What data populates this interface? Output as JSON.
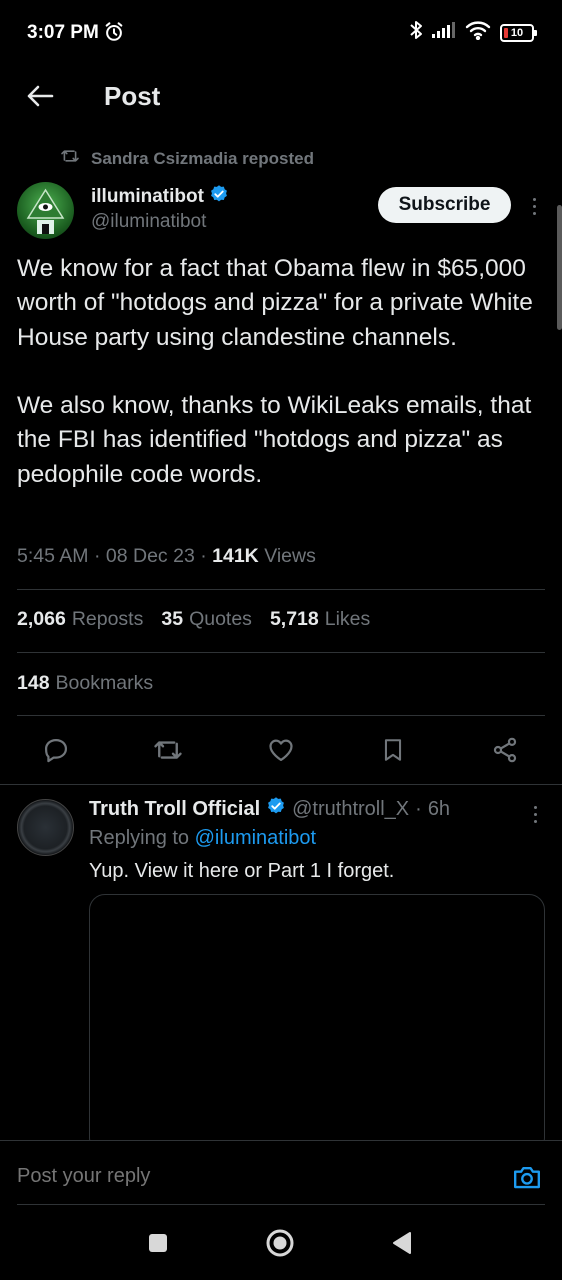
{
  "status_bar": {
    "time": "3:07 PM",
    "battery": "10",
    "icons": [
      "alarm-icon",
      "bluetooth-icon",
      "signal-icon",
      "wifi-icon",
      "battery-icon"
    ]
  },
  "header": {
    "title": "Post"
  },
  "post": {
    "repost_by": "Sandra Csizmadia reposted",
    "author_name": "illuminatibot",
    "author_handle": "@iluminatibot",
    "subscribe_label": "Subscribe",
    "text": "We know for a fact that Obama flew in $65,000 worth of \"hotdogs and pizza\" for a private White House party using clandestine channels.\n\nWe also know, thanks to WikiLeaks emails, that the FBI has identified \"hotdogs and pizza\" as pedophile code words.",
    "time": "5:45 AM",
    "date": "08 Dec 23",
    "views_count": "141K",
    "views_label": "Views",
    "reposts_count": "2,066",
    "reposts_label": "Reposts",
    "quotes_count": "35",
    "quotes_label": "Quotes",
    "likes_count": "5,718",
    "likes_label": "Likes",
    "bookmarks_count": "148",
    "bookmarks_label": "Bookmarks"
  },
  "reply": {
    "author_name": "Truth Troll Official",
    "author_handle": "@truthtroll_X",
    "age": "6h",
    "replying_prefix": "Replying to",
    "replying_to": "@iluminatibot",
    "text": "Yup. View it here or Part 1 I forget."
  },
  "composer": {
    "placeholder": "Post your reply"
  },
  "colors": {
    "background": "#000000",
    "text_primary": "#e7e9ea",
    "text_secondary": "#71767b",
    "accent": "#1d9bf0",
    "verified": "#1d9bf0",
    "divider": "#2f3336"
  }
}
